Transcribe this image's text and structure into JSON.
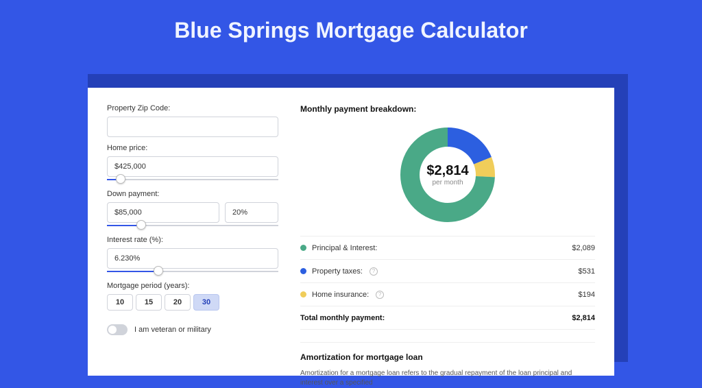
{
  "title": "Blue Springs Mortgage Calculator",
  "form": {
    "zip_label": "Property Zip Code:",
    "zip_value": "",
    "price_label": "Home price:",
    "price_value": "$425,000",
    "price_slider_pct": 8,
    "down_label": "Down payment:",
    "down_value": "$85,000",
    "down_pct_value": "20%",
    "down_slider_pct": 20,
    "rate_label": "Interest rate (%):",
    "rate_value": "6.230%",
    "rate_slider_pct": 30,
    "period_label": "Mortgage period (years):",
    "periods": [
      "10",
      "15",
      "20",
      "30"
    ],
    "period_selected": 3,
    "veteran_label": "I am veteran or military"
  },
  "breakdown": {
    "title": "Monthly payment breakdown:",
    "center_value": "$2,814",
    "center_sub": "per month",
    "items": [
      {
        "label": "Principal & Interest:",
        "value": "$2,089",
        "num": 2089,
        "color": "#4aa987",
        "info": false
      },
      {
        "label": "Property taxes:",
        "value": "$531",
        "num": 531,
        "color": "#2c5fe0",
        "info": true
      },
      {
        "label": "Home insurance:",
        "value": "$194",
        "num": 194,
        "color": "#f0cd5a",
        "info": true
      }
    ],
    "total_label": "Total monthly payment:",
    "total_value": "$2,814",
    "total_num": 2814
  },
  "amort": {
    "title": "Amortization for mortgage loan",
    "text": "Amortization for a mortgage loan refers to the gradual repayment of the loan principal and interest over a specified"
  },
  "chart_data": {
    "type": "pie",
    "title": "Monthly payment breakdown",
    "series": [
      {
        "name": "Principal & Interest",
        "value": 2089,
        "color": "#4aa987"
      },
      {
        "name": "Property taxes",
        "value": 531,
        "color": "#2c5fe0"
      },
      {
        "name": "Home insurance",
        "value": 194,
        "color": "#f0cd5a"
      }
    ],
    "center_label": "$2,814 per month"
  }
}
